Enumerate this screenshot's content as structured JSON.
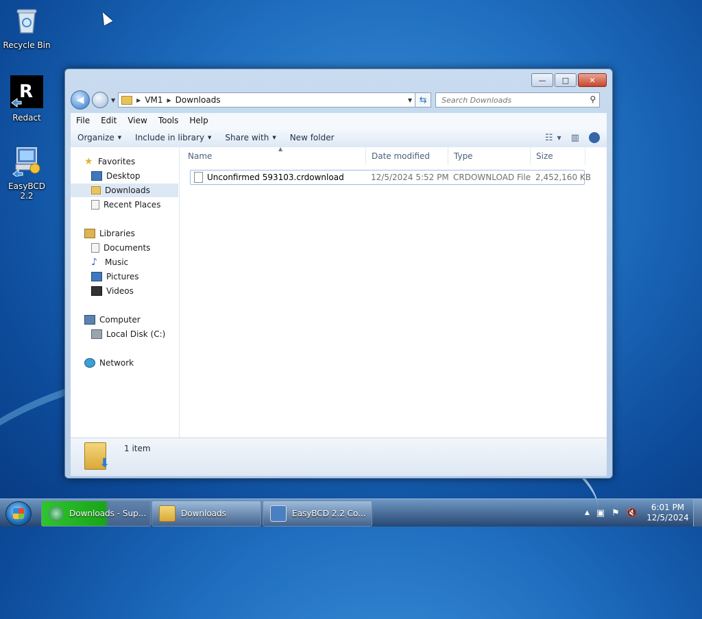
{
  "desktop": {
    "icons": [
      {
        "label": "Recycle Bin"
      },
      {
        "label": "Redact"
      },
      {
        "label": "EasyBCD 2.2"
      }
    ]
  },
  "window": {
    "controls": {
      "minimize": "—",
      "maximize": "□",
      "close": "✕"
    },
    "address": {
      "crumbs": [
        "VM1",
        "Downloads"
      ]
    },
    "search": {
      "placeholder": "Search Downloads"
    },
    "menu": [
      "File",
      "Edit",
      "View",
      "Tools",
      "Help"
    ],
    "commands": [
      "Organize",
      "Include in library",
      "Share with",
      "New folder"
    ],
    "nav_pane": {
      "favorites": {
        "label": "Favorites",
        "items": [
          "Desktop",
          "Downloads",
          "Recent Places"
        ]
      },
      "libraries": {
        "label": "Libraries",
        "items": [
          "Documents",
          "Music",
          "Pictures",
          "Videos"
        ]
      },
      "computer": {
        "label": "Computer",
        "items": [
          "Local Disk (C:)"
        ]
      },
      "network": {
        "label": "Network"
      }
    },
    "columns": [
      "Name",
      "Date modified",
      "Type",
      "Size"
    ],
    "files": [
      {
        "name": "Unconfirmed 593103.crdownload",
        "date": "12/5/2024 5:52 PM",
        "type": "CRDOWNLOAD File",
        "size": "2,452,160 KB"
      }
    ],
    "details": {
      "count": "1 item"
    }
  },
  "taskbar": {
    "buttons": [
      {
        "label": "Downloads - Sup..."
      },
      {
        "label": "Downloads"
      },
      {
        "label": "EasyBCD 2.2  Co..."
      }
    ],
    "clock": {
      "time": "6:01 PM",
      "date": "12/5/2024"
    }
  },
  "colors": {
    "accent": "#2f66ad",
    "selection": "#dde8f5",
    "progress_green": "#2ec52e"
  }
}
